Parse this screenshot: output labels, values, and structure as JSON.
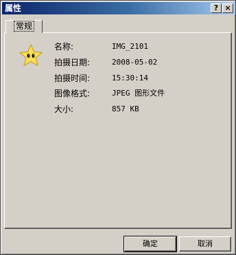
{
  "window": {
    "title": "属性",
    "help_label": "?",
    "close_label": "×"
  },
  "tabs": [
    {
      "label": "常规",
      "selected": true
    }
  ],
  "file_icon": "smiley-star-icon",
  "properties": [
    {
      "label": "名称:",
      "value": "IMG_2101"
    },
    {
      "label": "拍摄日期:",
      "value": "2008-05-02"
    },
    {
      "label": "拍摄时间:",
      "value": "15:30:14"
    },
    {
      "label": "图像格式:",
      "value": "JPEG 图形文件"
    },
    {
      "label": "大小:",
      "value": "857 KB"
    }
  ],
  "buttons": {
    "ok": "确定",
    "cancel": "取消"
  },
  "colors": {
    "title_gradient_start": "#0a246a",
    "title_gradient_end": "#a6caf0",
    "face": "#d4d0c8",
    "star_fill": "#f8e05a"
  }
}
